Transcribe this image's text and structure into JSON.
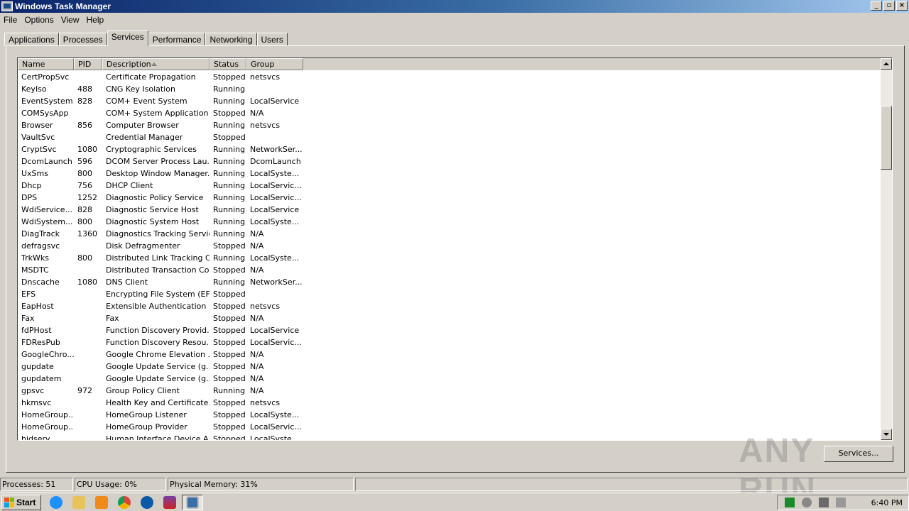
{
  "window": {
    "title": "Windows Task Manager"
  },
  "menu": [
    "File",
    "Options",
    "View",
    "Help"
  ],
  "tabs": [
    "Applications",
    "Processes",
    "Services",
    "Performance",
    "Networking",
    "Users"
  ],
  "active_tab": "Services",
  "columns": [
    "Name",
    "PID",
    "Description",
    "Status",
    "Group"
  ],
  "sort_column": "Description",
  "rows": [
    {
      "name": "CertPropSvc",
      "pid": "",
      "desc": "Certificate Propagation",
      "status": "Stopped",
      "group": "netsvcs"
    },
    {
      "name": "KeyIso",
      "pid": "488",
      "desc": "CNG Key Isolation",
      "status": "Running",
      "group": ""
    },
    {
      "name": "EventSystem",
      "pid": "828",
      "desc": "COM+ Event System",
      "status": "Running",
      "group": "LocalService"
    },
    {
      "name": "COMSysApp",
      "pid": "",
      "desc": "COM+ System Application",
      "status": "Stopped",
      "group": "N/A"
    },
    {
      "name": "Browser",
      "pid": "856",
      "desc": "Computer Browser",
      "status": "Running",
      "group": "netsvcs"
    },
    {
      "name": "VaultSvc",
      "pid": "",
      "desc": "Credential Manager",
      "status": "Stopped",
      "group": ""
    },
    {
      "name": "CryptSvc",
      "pid": "1080",
      "desc": "Cryptographic Services",
      "status": "Running",
      "group": "NetworkSer..."
    },
    {
      "name": "DcomLaunch",
      "pid": "596",
      "desc": "DCOM Server Process Lau...",
      "status": "Running",
      "group": "DcomLaunch"
    },
    {
      "name": "UxSms",
      "pid": "800",
      "desc": "Desktop Window Manager...",
      "status": "Running",
      "group": "LocalSyste..."
    },
    {
      "name": "Dhcp",
      "pid": "756",
      "desc": "DHCP Client",
      "status": "Running",
      "group": "LocalServic..."
    },
    {
      "name": "DPS",
      "pid": "1252",
      "desc": "Diagnostic Policy Service",
      "status": "Running",
      "group": "LocalServic..."
    },
    {
      "name": "WdiService...",
      "pid": "828",
      "desc": "Diagnostic Service Host",
      "status": "Running",
      "group": "LocalService"
    },
    {
      "name": "WdiSystem...",
      "pid": "800",
      "desc": "Diagnostic System Host",
      "status": "Running",
      "group": "LocalSyste..."
    },
    {
      "name": "DiagTrack",
      "pid": "1360",
      "desc": "Diagnostics Tracking Service",
      "status": "Running",
      "group": "N/A"
    },
    {
      "name": "defragsvc",
      "pid": "",
      "desc": "Disk Defragmenter",
      "status": "Stopped",
      "group": "N/A"
    },
    {
      "name": "TrkWks",
      "pid": "800",
      "desc": "Distributed Link Tracking C...",
      "status": "Running",
      "group": "LocalSyste..."
    },
    {
      "name": "MSDTC",
      "pid": "",
      "desc": "Distributed Transaction Co...",
      "status": "Stopped",
      "group": "N/A"
    },
    {
      "name": "Dnscache",
      "pid": "1080",
      "desc": "DNS Client",
      "status": "Running",
      "group": "NetworkSer..."
    },
    {
      "name": "EFS",
      "pid": "",
      "desc": "Encrypting File System (EFS)",
      "status": "Stopped",
      "group": ""
    },
    {
      "name": "EapHost",
      "pid": "",
      "desc": "Extensible Authentication ...",
      "status": "Stopped",
      "group": "netsvcs"
    },
    {
      "name": "Fax",
      "pid": "",
      "desc": "Fax",
      "status": "Stopped",
      "group": "N/A"
    },
    {
      "name": "fdPHost",
      "pid": "",
      "desc": "Function Discovery Provid...",
      "status": "Stopped",
      "group": "LocalService"
    },
    {
      "name": "FDResPub",
      "pid": "",
      "desc": "Function Discovery Resou...",
      "status": "Stopped",
      "group": "LocalServic..."
    },
    {
      "name": "GoogleChro...",
      "pid": "",
      "desc": "Google Chrome Elevation ...",
      "status": "Stopped",
      "group": "N/A"
    },
    {
      "name": "gupdate",
      "pid": "",
      "desc": "Google Update Service (g...",
      "status": "Stopped",
      "group": "N/A"
    },
    {
      "name": "gupdatem",
      "pid": "",
      "desc": "Google Update Service (g...",
      "status": "Stopped",
      "group": "N/A"
    },
    {
      "name": "gpsvc",
      "pid": "972",
      "desc": "Group Policy Client",
      "status": "Running",
      "group": "N/A"
    },
    {
      "name": "hkmsvc",
      "pid": "",
      "desc": "Health Key and Certificate...",
      "status": "Stopped",
      "group": "netsvcs"
    },
    {
      "name": "HomeGroup...",
      "pid": "",
      "desc": "HomeGroup Listener",
      "status": "Stopped",
      "group": "LocalSyste..."
    },
    {
      "name": "HomeGroup...",
      "pid": "",
      "desc": "HomeGroup Provider",
      "status": "Stopped",
      "group": "LocalServic..."
    },
    {
      "name": "hidserv",
      "pid": "",
      "desc": "Human Interface Device A...",
      "status": "Stopped",
      "group": "LocalSyste..."
    }
  ],
  "services_button": "Services...",
  "watermark": "ANY RUN",
  "status": {
    "processes": "Processes: 51",
    "cpu": "CPU Usage: 0%",
    "memory": "Physical Memory: 31%"
  },
  "taskbar": {
    "start": "Start",
    "clock": "6:40 PM",
    "quick_icons": [
      "ie-icon",
      "explorer-icon",
      "media-player-icon",
      "chrome-icon",
      "edge-icon",
      "winrar-icon",
      "task-manager-icon"
    ],
    "tray_icons": [
      "network-green-icon",
      "speaker-icon",
      "network-icon",
      "flag-icon"
    ]
  }
}
